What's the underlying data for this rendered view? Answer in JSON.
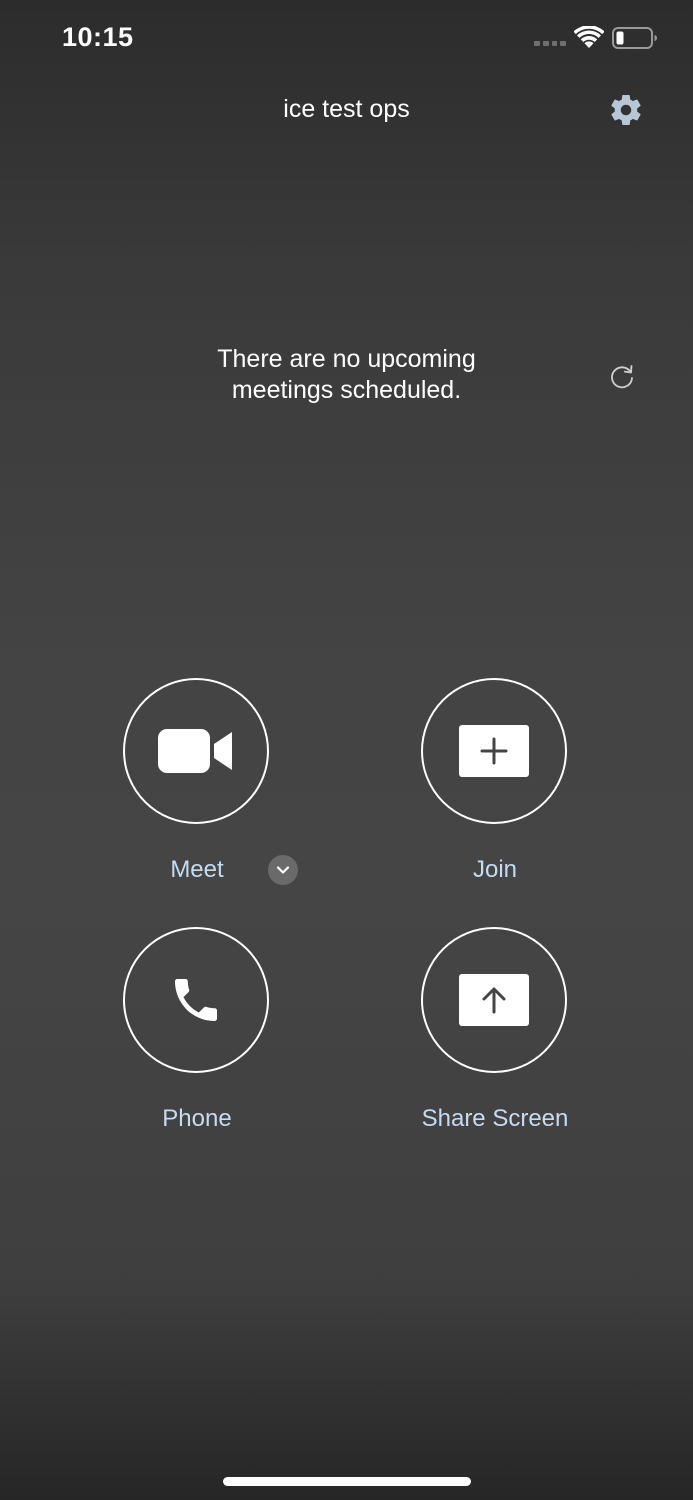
{
  "status_bar": {
    "time": "10:15",
    "icons": [
      "signal-icon",
      "wifi-icon",
      "battery-icon"
    ]
  },
  "header": {
    "title": "ice test ops",
    "settings_icon": "gear-icon"
  },
  "meetings": {
    "line1": "There are no upcoming",
    "line2": "meetings scheduled.",
    "refresh_icon": "refresh-icon"
  },
  "actions": {
    "meet": {
      "label": "Meet",
      "icon": "video-camera-icon",
      "dropdown_icon": "chevron-down-icon"
    },
    "join": {
      "label": "Join",
      "icon": "plus-box-icon"
    },
    "phone": {
      "label": "Phone",
      "icon": "phone-icon"
    },
    "share_screen": {
      "label": "Share Screen",
      "icon": "upload-box-icon"
    }
  },
  "colors": {
    "background": "#444444",
    "label": "#c5dbf0",
    "icon": "#ffffff",
    "settings_icon": "#b8c7d6"
  }
}
